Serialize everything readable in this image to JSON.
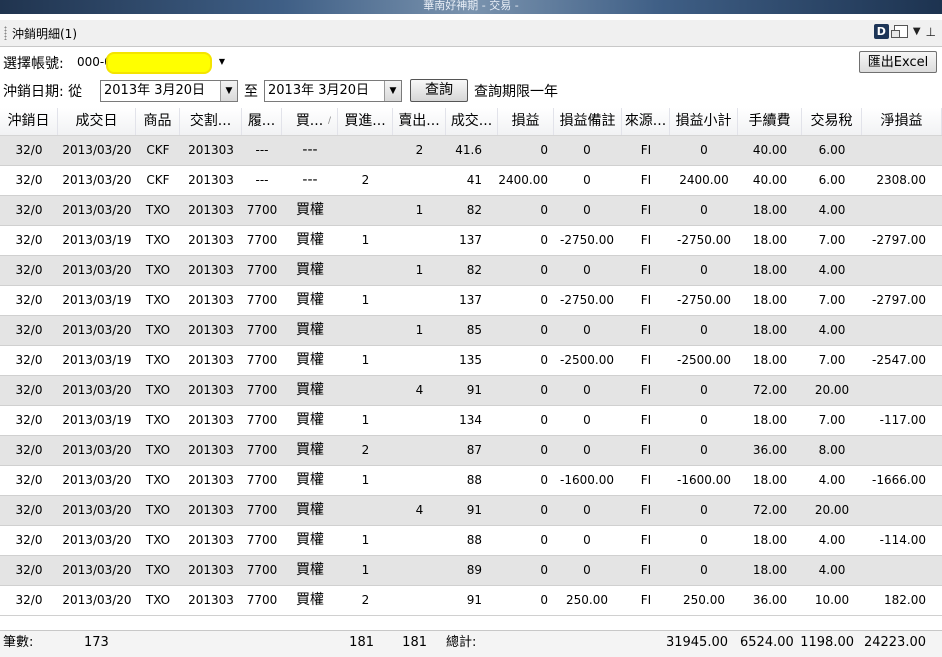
{
  "window": {
    "title": "華南好神期 - 交易 -"
  },
  "panel": {
    "title": "沖銷明細(1)",
    "d_badge": "D",
    "dropdown_icon": "chevron-down-icon",
    "pin_icon": "pin-icon"
  },
  "filters": {
    "account_label": "選擇帳號:",
    "account_value": "000-0",
    "export_label": "匯出Excel",
    "date_label": "沖銷日期: 從",
    "date_from": "2013年 3月20日",
    "to_label": "至",
    "date_to": "2013年 3月20日",
    "query_label": "查詢",
    "query_note": "查詢期限一年"
  },
  "columns": [
    "沖銷日",
    "成交日",
    "商品",
    "交割...",
    "履...",
    "買...",
    "買進...",
    "賣出...",
    "成交...",
    "損益",
    "損益備註",
    "來源...",
    "損益小計",
    "手續費",
    "交易稅",
    "淨損益"
  ],
  "rows": [
    [
      "32/0",
      "2013/03/20",
      "CKF",
      "201303",
      "---",
      "---",
      "",
      "2",
      "41.6",
      "0",
      "0",
      "FI",
      "0",
      "40.00",
      "6.00",
      ""
    ],
    [
      "32/0",
      "2013/03/20",
      "CKF",
      "201303",
      "---",
      "---",
      "2",
      "",
      "41",
      "2400.00",
      "0",
      "FI",
      "2400.00",
      "40.00",
      "6.00",
      "2308.00"
    ],
    [
      "32/0",
      "2013/03/20",
      "TXO",
      "201303",
      "7700",
      "買權",
      "",
      "1",
      "82",
      "0",
      "0",
      "FI",
      "0",
      "18.00",
      "4.00",
      ""
    ],
    [
      "32/0",
      "2013/03/19",
      "TXO",
      "201303",
      "7700",
      "買權",
      "1",
      "",
      "137",
      "0",
      "-2750.00",
      "FI",
      "-2750.00",
      "18.00",
      "7.00",
      "-2797.00"
    ],
    [
      "32/0",
      "2013/03/20",
      "TXO",
      "201303",
      "7700",
      "買權",
      "",
      "1",
      "82",
      "0",
      "0",
      "FI",
      "0",
      "18.00",
      "4.00",
      ""
    ],
    [
      "32/0",
      "2013/03/19",
      "TXO",
      "201303",
      "7700",
      "買權",
      "1",
      "",
      "137",
      "0",
      "-2750.00",
      "FI",
      "-2750.00",
      "18.00",
      "7.00",
      "-2797.00"
    ],
    [
      "32/0",
      "2013/03/20",
      "TXO",
      "201303",
      "7700",
      "買權",
      "",
      "1",
      "85",
      "0",
      "0",
      "FI",
      "0",
      "18.00",
      "4.00",
      ""
    ],
    [
      "32/0",
      "2013/03/19",
      "TXO",
      "201303",
      "7700",
      "買權",
      "1",
      "",
      "135",
      "0",
      "-2500.00",
      "FI",
      "-2500.00",
      "18.00",
      "7.00",
      "-2547.00"
    ],
    [
      "32/0",
      "2013/03/20",
      "TXO",
      "201303",
      "7700",
      "買權",
      "",
      "4",
      "91",
      "0",
      "0",
      "FI",
      "0",
      "72.00",
      "20.00",
      ""
    ],
    [
      "32/0",
      "2013/03/19",
      "TXO",
      "201303",
      "7700",
      "買權",
      "1",
      "",
      "134",
      "0",
      "0",
      "FI",
      "0",
      "18.00",
      "7.00",
      "-117.00"
    ],
    [
      "32/0",
      "2013/03/20",
      "TXO",
      "201303",
      "7700",
      "買權",
      "2",
      "",
      "87",
      "0",
      "0",
      "FI",
      "0",
      "36.00",
      "8.00",
      ""
    ],
    [
      "32/0",
      "2013/03/20",
      "TXO",
      "201303",
      "7700",
      "買權",
      "1",
      "",
      "88",
      "0",
      "-1600.00",
      "FI",
      "-1600.00",
      "18.00",
      "4.00",
      "-1666.00"
    ],
    [
      "32/0",
      "2013/03/20",
      "TXO",
      "201303",
      "7700",
      "買權",
      "",
      "4",
      "91",
      "0",
      "0",
      "FI",
      "0",
      "72.00",
      "20.00",
      ""
    ],
    [
      "32/0",
      "2013/03/20",
      "TXO",
      "201303",
      "7700",
      "買權",
      "1",
      "",
      "88",
      "0",
      "0",
      "FI",
      "0",
      "18.00",
      "4.00",
      "-114.00"
    ],
    [
      "32/0",
      "2013/03/20",
      "TXO",
      "201303",
      "7700",
      "買權",
      "1",
      "",
      "89",
      "0",
      "0",
      "FI",
      "0",
      "18.00",
      "4.00",
      ""
    ],
    [
      "32/0",
      "2013/03/20",
      "TXO",
      "201303",
      "7700",
      "買權",
      "2",
      "",
      "91",
      "0",
      "250.00",
      "FI",
      "250.00",
      "36.00",
      "10.00",
      "182.00"
    ]
  ],
  "summary": {
    "count_label": "筆數:",
    "count": "173",
    "buy_total": "181",
    "sell_total": "181",
    "total_label": "總計:",
    "pl_subtotal": "31945.00",
    "fee": "6524.00",
    "tax": "1198.00",
    "net": "24223.00"
  },
  "colors": {
    "row_alt": "#e4e4e4",
    "row_white": "#ffffff",
    "highlight_mask": "#ffff00"
  }
}
